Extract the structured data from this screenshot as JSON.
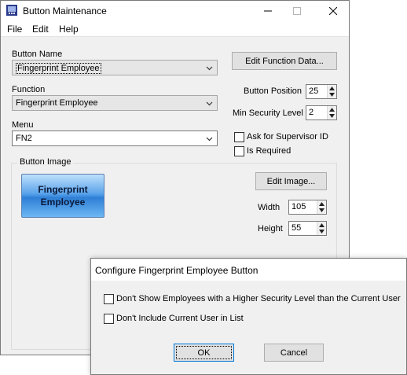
{
  "window": {
    "title": "Button Maintenance",
    "caption_buttons": {
      "minimize": "—",
      "maximize": "☐",
      "close": "✕"
    }
  },
  "menu": {
    "items": [
      "File",
      "Edit",
      "Help"
    ]
  },
  "form": {
    "button_name": {
      "label": "Button Name",
      "value": "Fingerprint Employee"
    },
    "function": {
      "label": "Function",
      "value": "Fingerprint Employee"
    },
    "menu_field": {
      "label": "Menu",
      "value": "FN2"
    },
    "edit_function_button": "Edit Function Data...",
    "button_position": {
      "label": "Button Position",
      "value": "25"
    },
    "min_security": {
      "label": "Min Security Level",
      "value": "2"
    },
    "ask_supervisor": {
      "label": "Ask for Supervisor ID",
      "checked": false
    },
    "is_required": {
      "label": "Is Required",
      "checked": false
    }
  },
  "image_group": {
    "label": "Button Image",
    "preview_line1": "Fingerprint",
    "preview_line2": "Employee",
    "edit_image_button": "Edit Image...",
    "width": {
      "label": "Width",
      "value": "105"
    },
    "height": {
      "label": "Height",
      "value": "55"
    }
  },
  "dialog": {
    "title": "Configure Fingerprint Employee Button",
    "option1": {
      "label": "Don't Show Employees with a Higher Security Level than the Current User",
      "checked": false
    },
    "option2": {
      "label": "Don't Include Current User in List",
      "checked": false
    },
    "ok_label": "OK",
    "cancel_label": "Cancel"
  },
  "colors": {
    "accent": "#0078d7",
    "window_bg": "#f0f0f0",
    "preview_button": "#3f8ee0"
  }
}
